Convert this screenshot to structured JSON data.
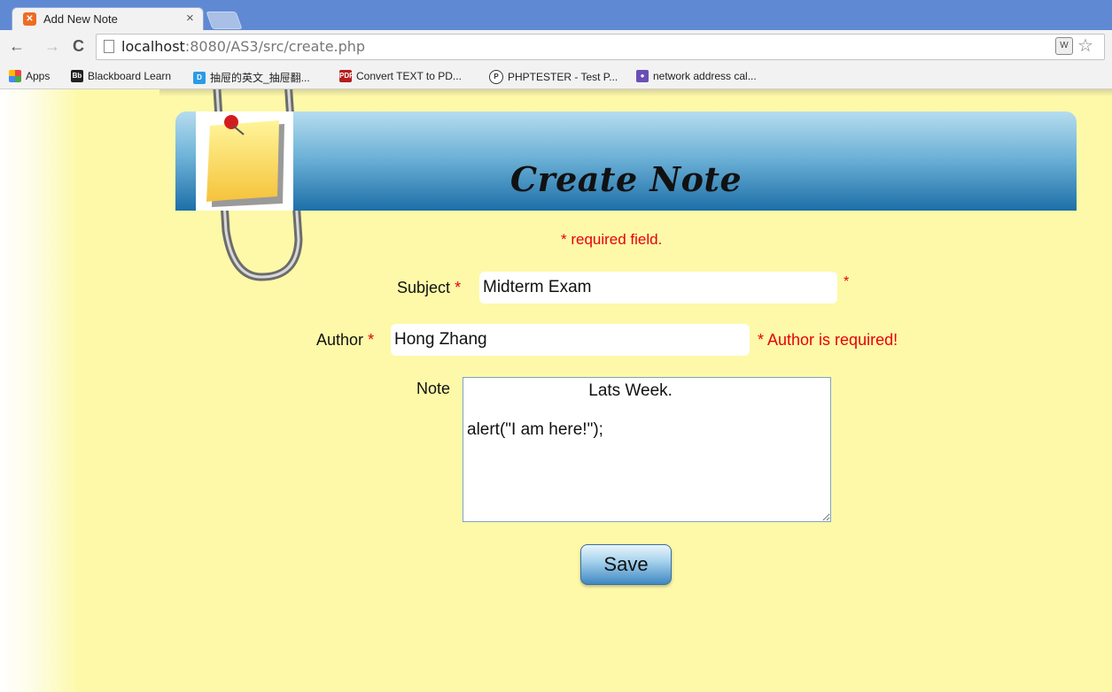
{
  "browser": {
    "tab_title": "Add New Note",
    "tab_close": "×",
    "url_host": "localhost",
    "url_rest": ":8080/AS3/src/create.php",
    "bookmarks": [
      {
        "label": "Apps",
        "icon": "apps-grid-icon",
        "color": "#e44"
      },
      {
        "label": "Blackboard Learn",
        "icon": "blackboard-icon",
        "color": "#222"
      },
      {
        "label": "抽屉的英文_抽屉翻...",
        "icon": "dict-icon",
        "color": "#2b9be8"
      },
      {
        "label": "Convert TEXT to PD...",
        "icon": "pdf-icon",
        "color": "#b51d1d"
      },
      {
        "label": "PHPTESTER - Test P...",
        "icon": "phptester-icon",
        "color": "#333"
      },
      {
        "label": "network address cal...",
        "icon": "network-icon",
        "color": "#6a4fb5"
      }
    ]
  },
  "page": {
    "title": "Create Note",
    "required_note": "* required field.",
    "subject": {
      "label": "Subject",
      "star": "*",
      "value": "Midterm Exam",
      "error": "*"
    },
    "author": {
      "label": "Author",
      "star": "*",
      "value": "Hong Zhang",
      "error": "* Author is required!"
    },
    "note": {
      "label": "Note",
      "value": "                          Lats Week.\n\nalert(\"I am here!\");"
    },
    "save_label": "Save"
  },
  "colors": {
    "background": "#fdf9a8",
    "error": "#e8000b",
    "banner_top": "#b6dcef",
    "banner_bottom": "#1d6fa8"
  }
}
